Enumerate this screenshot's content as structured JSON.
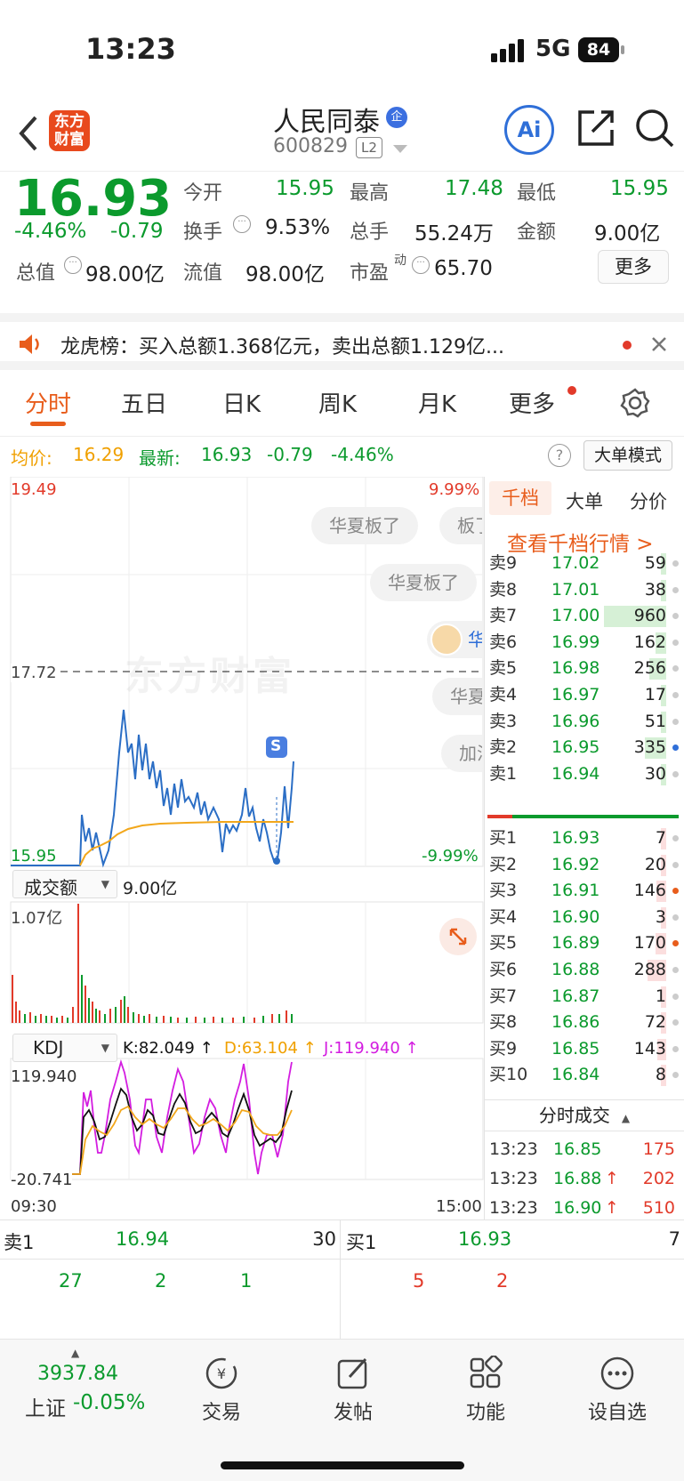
{
  "status": {
    "time": "13:23",
    "network": "5G",
    "battery": "84"
  },
  "header": {
    "logo_line1": "东方",
    "logo_line2": "财富",
    "name": "人民同泰",
    "badge": "企",
    "code": "600829",
    "level": "L2",
    "ai": "Ai"
  },
  "quote": {
    "price": "16.93",
    "pct": "-4.46%",
    "chg": "-0.79",
    "stats": [
      {
        "label": "今开",
        "value": "15.95"
      },
      {
        "label": "最高",
        "value": "17.48"
      },
      {
        "label": "最低",
        "value": "15.95"
      },
      {
        "label": "换手",
        "value": "9.53%"
      },
      {
        "label": "总手",
        "value": "55.24万"
      },
      {
        "label": "金额",
        "value": "9.00亿"
      },
      {
        "label": "总值",
        "value": "98.00亿"
      },
      {
        "label": "流值",
        "value": "98.00亿"
      },
      {
        "label": "市盈",
        "sup": "动",
        "value": "65.70"
      }
    ],
    "more": "更多"
  },
  "notice": {
    "text": "龙虎榜：买入总额1.368亿元，卖出总额1.129亿..."
  },
  "tabs": [
    "分时",
    "五日",
    "日K",
    "周K",
    "月K",
    "更多"
  ],
  "summary": {
    "avg_label": "均价:",
    "avg": "16.29",
    "latest_label": "最新:",
    "latest": "16.93",
    "chg": "-0.79",
    "pct": "-4.46%",
    "mode": "大单模式"
  },
  "chart": {
    "top_left": "19.49",
    "top_right": "9.99%",
    "bottom_left": "15.95",
    "bottom_right": "-9.99%",
    "mid": "17.72",
    "watermark": "东方财富",
    "bubbles": [
      "华夏板了",
      "板了",
      "华夏板了",
      "华",
      "华夏",
      "加油"
    ],
    "s_marker": "S",
    "vol_selector": "成交额",
    "vol_total": "9.00亿",
    "vol_max": "1.07亿",
    "kdj_selector": "KDJ",
    "kdj_k": "K:82.049 ↑",
    "kdj_d": "D:63.104 ↑",
    "kdj_j": "J:119.940 ↑",
    "kdj_max": "119.940",
    "kdj_min": "-20.741",
    "time_start": "09:30",
    "time_end": "15:00"
  },
  "orderbook": {
    "tabs": [
      "千档",
      "大单",
      "分价"
    ],
    "link": "查看千档行情 >",
    "asks": [
      {
        "name": "卖9",
        "price": "17.02",
        "vol": "59"
      },
      {
        "name": "卖8",
        "price": "17.01",
        "vol": "38"
      },
      {
        "name": "卖7",
        "price": "17.00",
        "vol": "960"
      },
      {
        "name": "卖6",
        "price": "16.99",
        "vol": "162"
      },
      {
        "name": "卖5",
        "price": "16.98",
        "vol": "256"
      },
      {
        "name": "卖4",
        "price": "16.97",
        "vol": "17"
      },
      {
        "name": "卖3",
        "price": "16.96",
        "vol": "51"
      },
      {
        "name": "卖2",
        "price": "16.95",
        "vol": "335"
      },
      {
        "name": "卖1",
        "price": "16.94",
        "vol": "30"
      }
    ],
    "bids": [
      {
        "name": "买1",
        "price": "16.93",
        "vol": "7"
      },
      {
        "name": "买2",
        "price": "16.92",
        "vol": "20"
      },
      {
        "name": "买3",
        "price": "16.91",
        "vol": "146"
      },
      {
        "name": "买4",
        "price": "16.90",
        "vol": "3"
      },
      {
        "name": "买5",
        "price": "16.89",
        "vol": "170"
      },
      {
        "name": "买6",
        "price": "16.88",
        "vol": "288"
      },
      {
        "name": "买7",
        "price": "16.87",
        "vol": "1"
      },
      {
        "name": "买8",
        "price": "16.86",
        "vol": "72"
      },
      {
        "name": "买9",
        "price": "16.85",
        "vol": "143"
      },
      {
        "name": "买10",
        "price": "16.84",
        "vol": "8"
      }
    ],
    "ticks_title": "分时成交",
    "ticks": [
      {
        "time": "13:23",
        "price": "16.85",
        "arrow": "",
        "vol": "175"
      },
      {
        "time": "13:23",
        "price": "16.88",
        "arrow": "↑",
        "vol": "202"
      },
      {
        "time": "13:23",
        "price": "16.90",
        "arrow": "↑",
        "vol": "510"
      }
    ]
  },
  "queue": {
    "left": {
      "name": "卖1",
      "price": "16.94",
      "vol": "30",
      "orders": [
        "27",
        "2",
        "1"
      ]
    },
    "right": {
      "name": "买1",
      "price": "16.93",
      "vol": "7",
      "orders": [
        "5",
        "2"
      ]
    }
  },
  "bottom_nav": {
    "index_value": "3937.84",
    "index_name": "上证",
    "index_pct": "-0.05%",
    "items": [
      "交易",
      "发帖",
      "功能",
      "设自选"
    ]
  }
}
